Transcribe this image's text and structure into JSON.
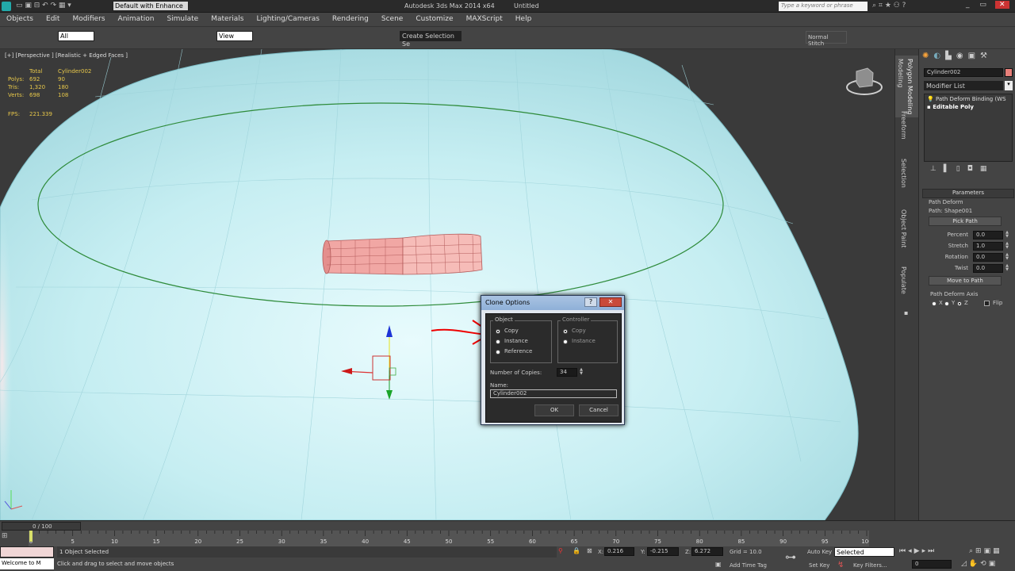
{
  "titlebar": {
    "workspace": "Default with Enhance",
    "app_title": "Autodesk 3ds Max  2014 x64",
    "doc_title": "Untitled",
    "search_placeholder": "Type a keyword or phrase"
  },
  "menus": [
    "Objects",
    "Edit",
    "Modifiers",
    "Animation",
    "Simulate",
    "Materials",
    "Lighting/Cameras",
    "Rendering",
    "Scene",
    "Customize",
    "MAXScript",
    "Help"
  ],
  "toolbar": {
    "selection_filter": "All",
    "ref_coord": "View",
    "named_sel": "Create Selection Se",
    "normal_stitch": "Normal Stitch"
  },
  "viewport": {
    "label": "[+] [Perspective ] [Realistic + Edged Faces ]",
    "stats": {
      "total_label": "Total",
      "object_label": "Cylinder002",
      "rows": [
        {
          "k": "Polys:",
          "t": "692",
          "o": "90"
        },
        {
          "k": "Tris:",
          "t": "1,320",
          "o": "180"
        },
        {
          "k": "Verts:",
          "t": "698",
          "o": "108"
        }
      ],
      "fps_label": "FPS:",
      "fps": "221.339"
    }
  },
  "clone_dialog": {
    "title": "Clone Options",
    "object_group": "Object",
    "object_options": [
      "Copy",
      "Instance",
      "Reference"
    ],
    "object_selected": 0,
    "controller_group": "Controller",
    "controller_options": [
      "Copy",
      "Instance"
    ],
    "controller_selected": 0,
    "copies_label": "Number of Copies:",
    "copies_value": "34",
    "name_label": "Name:",
    "name_value": "Cylinder002",
    "ok": "OK",
    "cancel": "Cancel"
  },
  "ribbon_tabs": [
    "Modeling",
    "Freeform",
    "Selection",
    "Object Paint",
    "Populate"
  ],
  "ribbon_active_sub": "Polygon Modeling",
  "command_panel": {
    "object_name": "Cylinder002",
    "object_color": "#e8807a",
    "modifier_list": "Modifier List",
    "stack": [
      "Path Deform Binding (WS",
      "Editable Poly"
    ],
    "rollout_title": "Parameters",
    "path_deform": "Path Deform",
    "path": "Path: Shape001",
    "pick_path": "Pick Path",
    "params": [
      {
        "k": "Percent",
        "v": "0.0"
      },
      {
        "k": "Stretch",
        "v": "1.0"
      },
      {
        "k": "Rotation",
        "v": "0.0"
      },
      {
        "k": "Twist",
        "v": "0.0"
      }
    ],
    "move_to_path": "Move to Path",
    "axis_title": "Path Deform Axis",
    "axes": [
      "X",
      "Y",
      "Z"
    ],
    "axis_selected": 2,
    "flip": "Flip"
  },
  "timeline": {
    "frame": "0 / 100",
    "ticks": [
      "0",
      "5",
      "10",
      "15",
      "20",
      "25",
      "30",
      "35",
      "40",
      "45",
      "50",
      "55",
      "60",
      "65",
      "70",
      "75",
      "80",
      "85",
      "90",
      "95",
      "100"
    ]
  },
  "status": {
    "listener": "Welcome to M",
    "selected": "1 Object Selected",
    "prompt": "Click and drag to select and move objects",
    "x_label": "X:",
    "x": "0.216",
    "y_label": "Y:",
    "y": "-0.215",
    "z_label": "Z:",
    "z": "6.272",
    "grid": "Grid = 10.0",
    "auto_key": "Auto Key",
    "auto_key_mode": "Selected",
    "set_key": "Set Key",
    "key_filters": "Key Filters...",
    "add_time_tag": "Add Time Tag",
    "frame_field": "0"
  }
}
